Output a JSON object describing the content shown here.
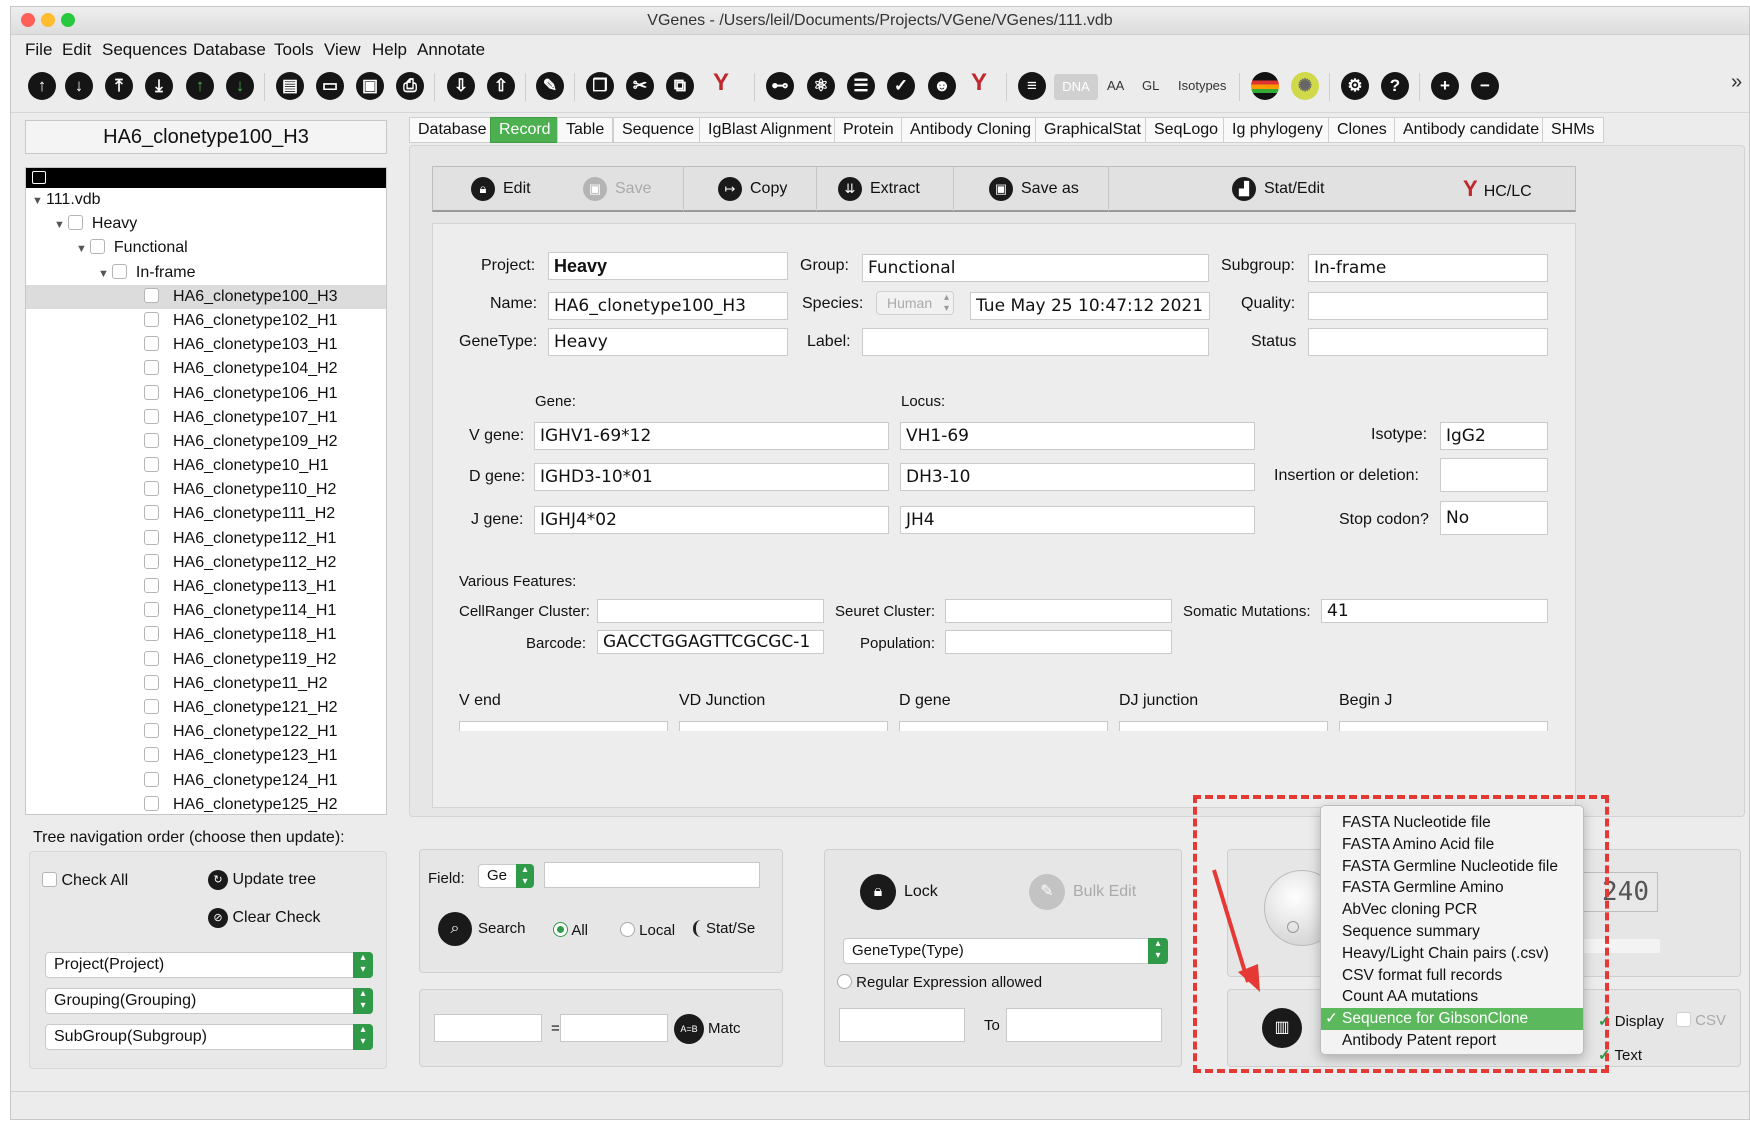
{
  "window": {
    "title": "VGenes - /Users/leil/Documents/Projects/VGene/VGenes/111.vdb"
  },
  "menu": [
    "File",
    "Edit",
    "Sequences",
    "Database",
    "Tools",
    "View",
    "Help",
    "Annotate"
  ],
  "toolbar": {
    "dna": "DNA",
    "aa": "AA",
    "gl": "GL",
    "isotypes": "Isotypes",
    "more": "»"
  },
  "record_name": "HA6_clonetype100_H3",
  "tree": {
    "root": "111.vdb",
    "level1": "Heavy",
    "level2": "Functional",
    "level3": "In-frame",
    "items": [
      "HA6_clonetype100_H3",
      "HA6_clonetype102_H1",
      "HA6_clonetype103_H1",
      "HA6_clonetype104_H2",
      "HA6_clonetype106_H1",
      "HA6_clonetype107_H1",
      "HA6_clonetype109_H2",
      "HA6_clonetype10_H1",
      "HA6_clonetype110_H2",
      "HA6_clonetype111_H2",
      "HA6_clonetype112_H1",
      "HA6_clonetype112_H2",
      "HA6_clonetype113_H1",
      "HA6_clonetype114_H1",
      "HA6_clonetype118_H1",
      "HA6_clonetype119_H2",
      "HA6_clonetype11_H2",
      "HA6_clonetype121_H2",
      "HA6_clonetype122_H1",
      "HA6_clonetype123_H1",
      "HA6_clonetype124_H1",
      "HA6_clonetype125_H2"
    ]
  },
  "nav": {
    "label": "Tree navigation order (choose then update):",
    "check_all": "Check All",
    "update_tree": "Update tree",
    "clear_check": "Clear Check",
    "select1": "Project(Project)",
    "select2": "Grouping(Grouping)",
    "select3": "SubGroup(Subgroup)"
  },
  "tabs": [
    "Database",
    "Record",
    "Table",
    "Sequence",
    "IgBlast Alignment",
    "Protein",
    "Antibody Cloning",
    "GraphicalStat",
    "SeqLogo",
    "Ig phylogeny",
    "Clones",
    "Antibody candidate",
    "SHMs"
  ],
  "actions": {
    "edit": "Edit",
    "save": "Save",
    "copy": "Copy",
    "extract": "Extract",
    "save_as": "Save as",
    "stat_edit": "Stat/Edit",
    "hclc": "HC/LC"
  },
  "form": {
    "project_label": "Project:",
    "project": "Heavy",
    "group_label": "Group:",
    "group": "Functional",
    "subgroup_label": "Subgroup:",
    "subgroup": "In-frame",
    "name_label": "Name:",
    "name": "HA6_clonetype100_H3",
    "species_label": "Species:",
    "species": "Human",
    "date": "Tue May 25 10:47:12 2021",
    "quality_label": "Quality:",
    "quality": "",
    "genetype_label": "GeneType:",
    "genetype": "Heavy",
    "label_label": "Label:",
    "label": "",
    "status_label": "Status",
    "status": "",
    "gene_header": "Gene:",
    "locus_header": "Locus:",
    "vgene_label": "V gene:",
    "vgene": "IGHV1-69*12",
    "vlocus": "VH1-69",
    "dgene_label": "D gene:",
    "dgene": "IGHD3-10*01",
    "dlocus": "DH3-10",
    "jgene_label": "J gene:",
    "jgene": "IGHJ4*02",
    "jlocus": "JH4",
    "isotype_label": "Isotype:",
    "isotype": "IgG2",
    "indel_label": "Insertion or deletion:",
    "indel": "",
    "stop_label": "Stop codon?",
    "stop": "No",
    "features_label": "Various Features:",
    "cellranger_label": "CellRanger Cluster:",
    "cellranger": "",
    "seurat_label": "Seuret Cluster:",
    "seurat": "",
    "somatic_label": "Somatic Mutations:",
    "somatic": "41",
    "barcode_label": "Barcode:",
    "barcode": "GACCTGGAGTTCGCGC-1",
    "population_label": "Population:",
    "population": "",
    "junction_headers": [
      "V end",
      "VD Junction",
      "D gene",
      "DJ junction",
      "Begin J"
    ]
  },
  "search_panel": {
    "field_label": "Field:",
    "field_value": "Ge",
    "search": "Search",
    "all": "All",
    "local": "Local",
    "stat": "Stat/Se",
    "equals": "=",
    "match": "Matc",
    "ab_icon": "A=B"
  },
  "lock_panel": {
    "lock": "Lock",
    "bulk_edit": "Bulk Edit",
    "genetype_select": "GeneType(Type)",
    "regex": "Regular Expression allowed",
    "to": "To"
  },
  "right_panel": {
    "display": "Display",
    "csv": "CSV",
    "text": "Text",
    "lcd": "240"
  },
  "context_menu": {
    "items": [
      "FASTA Nucleotide file",
      "FASTA Amino Acid file",
      "FASTA Germline Nucleotide file",
      "FASTA Germline Amino",
      "AbVec cloning PCR",
      "Sequence summary",
      "Heavy/Light Chain pairs (.csv)",
      "CSV format full records",
      "Count AA mutations",
      "Sequence for GibsonClone",
      "Antibody Patent report"
    ],
    "selected": "Sequence for GibsonClone",
    "check": "✓"
  },
  "colors": {
    "accent": "#4caf50",
    "annotation": "#e53935"
  }
}
